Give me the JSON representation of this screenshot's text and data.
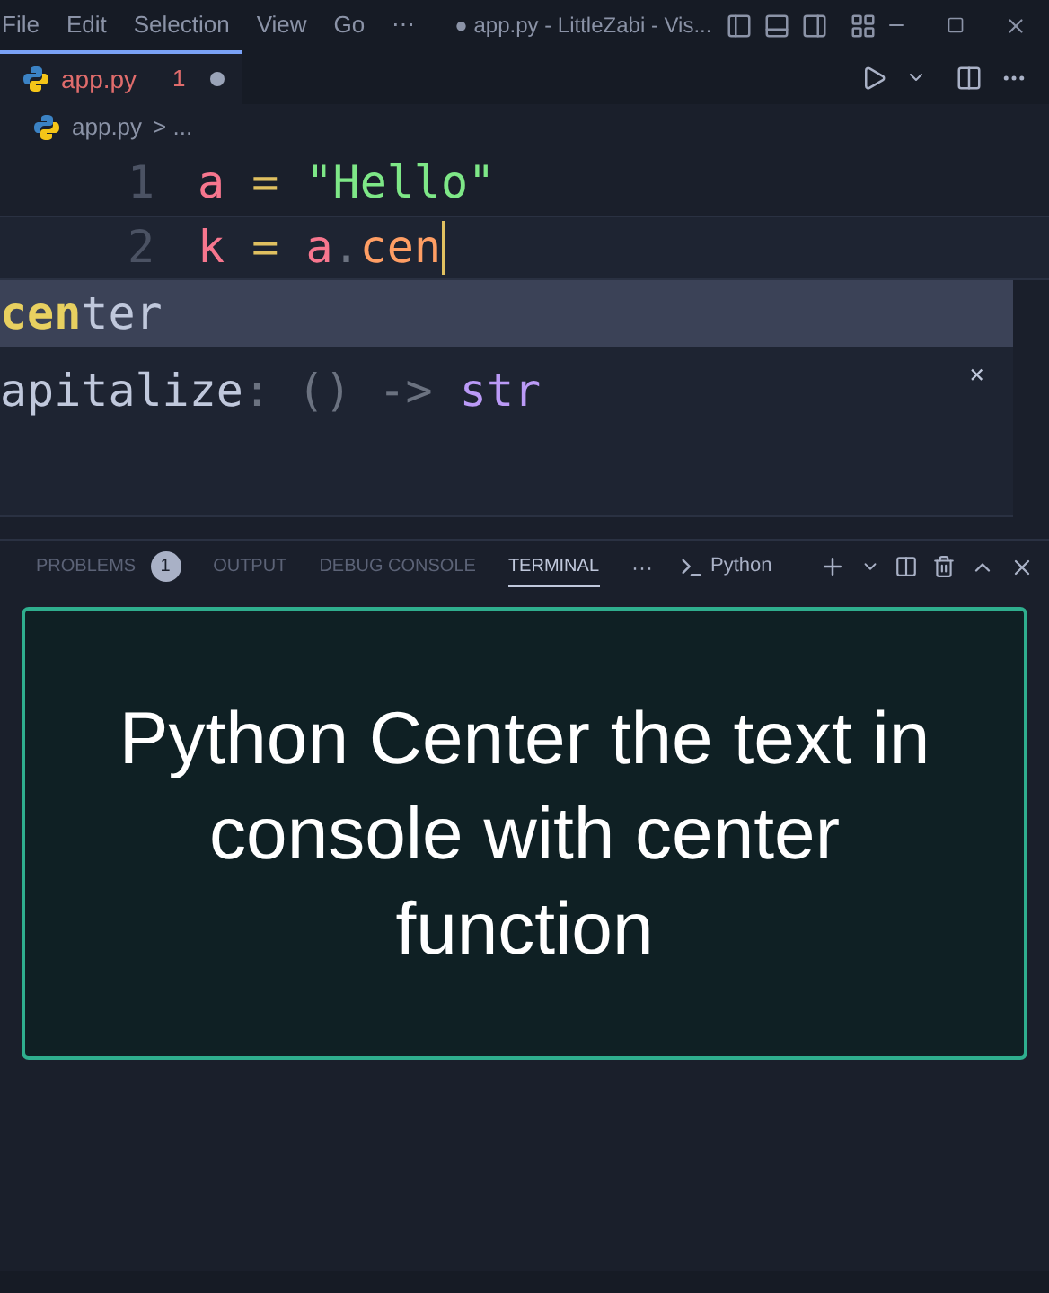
{
  "menu": [
    "File",
    "Edit",
    "Selection",
    "View",
    "Go",
    "⋯"
  ],
  "window": {
    "title": "● app.py - LittleZabi - Vis..."
  },
  "tabs": [
    {
      "label": "app.py",
      "problems": "1",
      "modified": true,
      "selected": true
    }
  ],
  "breadcrumb": {
    "file": "app.py",
    "rest": "> ..."
  },
  "code": [
    {
      "number": "1",
      "tokens": [
        {
          "text": "a",
          "kind": "var"
        },
        {
          "text": " = ",
          "kind": "op"
        },
        {
          "text": "\"Hello\"",
          "kind": "str"
        }
      ]
    },
    {
      "number": "2",
      "tokens": [
        {
          "text": "k",
          "kind": "var"
        },
        {
          "text": " = ",
          "kind": "op"
        },
        {
          "text": "a",
          "kind": "var"
        },
        {
          "text": ".",
          "kind": "dot"
        },
        {
          "text": "cen",
          "kind": "attr"
        }
      ]
    }
  ],
  "suggestions": [
    {
      "match": "cen",
      "rest": "ter",
      "selected": true
    }
  ],
  "details": {
    "name": "apitalize",
    "sig": ": () -> ",
    "type": "str",
    "close": "×"
  },
  "panel": {
    "tabs": [
      {
        "label": "PROBLEMS",
        "badge": "1",
        "selected": false
      },
      {
        "label": "OUTPUT",
        "selected": false
      },
      {
        "label": "DEBUG CONSOLE",
        "selected": false
      },
      {
        "label": "TERMINAL",
        "selected": true
      }
    ],
    "more": "···",
    "shell": "Python"
  },
  "caption": "Python Center the text in console with center function"
}
